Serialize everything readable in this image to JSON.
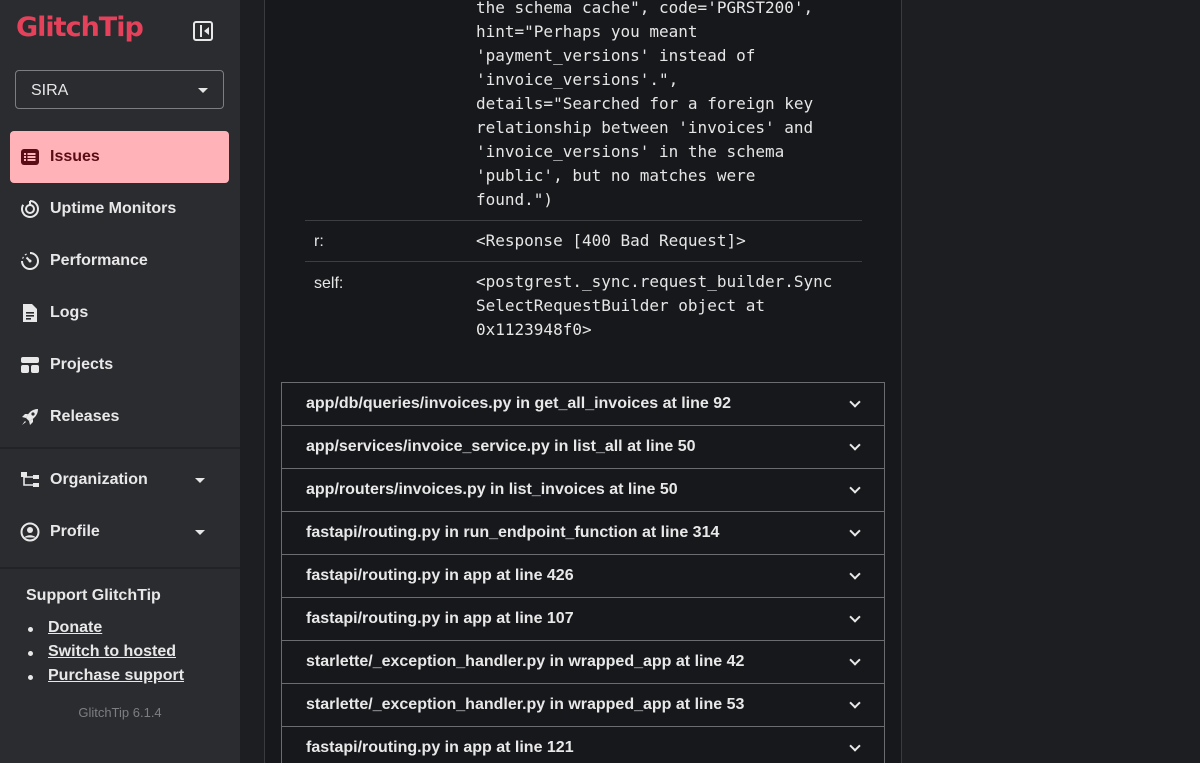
{
  "app": {
    "logo_text": "GlitchTip",
    "version": "GlitchTip 6.1.4"
  },
  "org_select": {
    "value": "SIRA"
  },
  "nav": {
    "items": [
      {
        "label": "Issues",
        "icon": "list-icon",
        "active": true
      },
      {
        "label": "Uptime Monitors",
        "icon": "uptime-icon"
      },
      {
        "label": "Performance",
        "icon": "gauge-icon"
      },
      {
        "label": "Logs",
        "icon": "document-icon"
      },
      {
        "label": "Projects",
        "icon": "layout-icon"
      },
      {
        "label": "Releases",
        "icon": "rocket-icon"
      }
    ],
    "groups": [
      {
        "label": "Organization",
        "icon": "org-chart-icon"
      },
      {
        "label": "Profile",
        "icon": "user-circle-icon"
      }
    ]
  },
  "support": {
    "title": "Support GlitchTip",
    "links": [
      "Donate",
      "Switch to hosted",
      "Purchase support"
    ]
  },
  "variables": [
    {
      "key": "",
      "value": "the schema cache\", code='PGRST200',\nhint=\"Perhaps you meant\n'payment_versions' instead of\n'invoice_versions'.\",\ndetails=\"Searched for a foreign key\nrelationship between 'invoices' and\n'invoice_versions' in the schema\n'public', but no matches were\nfound.\")"
    },
    {
      "key": "r:",
      "value": "<Response [400 Bad Request]>"
    },
    {
      "key": "self:",
      "value": "<postgrest._sync.request_builder.Sync\nSelectRequestBuilder object at\n0x1123948f0>"
    }
  ],
  "frames": [
    "app/db/queries/invoices.py in get_all_invoices at line 92",
    "app/services/invoice_service.py in list_all at line 50",
    "app/routers/invoices.py in list_invoices at line 50",
    "fastapi/routing.py in run_endpoint_function at line 314",
    "fastapi/routing.py in app at line 426",
    "fastapi/routing.py in app at line 107",
    "starlette/_exception_handler.py in wrapped_app at line 42",
    "starlette/_exception_handler.py in wrapped_app at line 53",
    "fastapi/routing.py in app at line 121"
  ],
  "colors": {
    "accent": "#e5415a",
    "active_nav_bg": "#ffb3b8",
    "active_nav_text": "#5a0c16",
    "sidebar_bg": "#2b2c30",
    "panel_bg": "#17181b"
  }
}
